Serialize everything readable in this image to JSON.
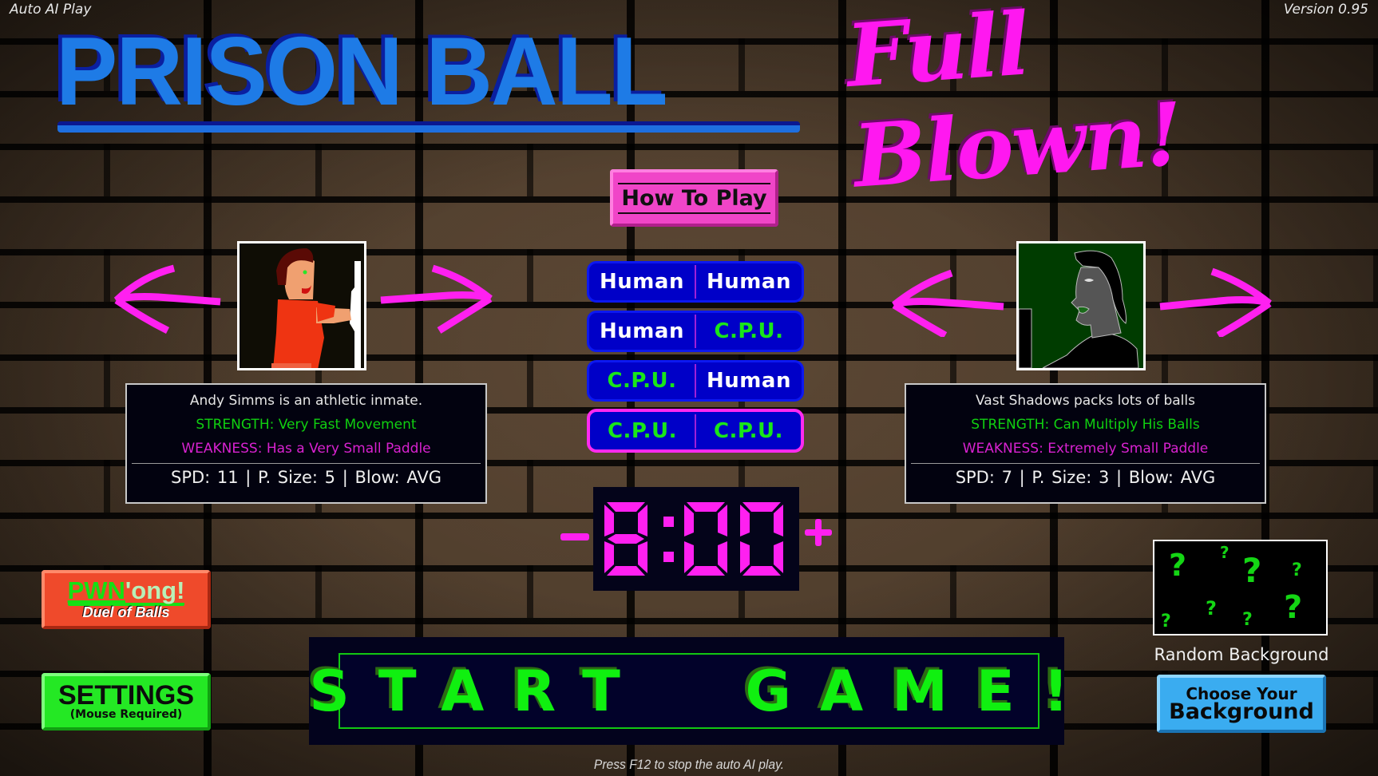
{
  "header": {
    "mode_label": "Auto AI Play",
    "version": "Version 0.95",
    "title_main": "PRISON BALL",
    "title_sub": "Full Blown!"
  },
  "how_to_play": {
    "label": "How To Play"
  },
  "colors": {
    "human": "#ffffff",
    "cpu": "#19e619",
    "accent_pink": "#ff20f0",
    "title_blue": "#1e7be6",
    "start_green": "#10f010"
  },
  "player_modes": [
    {
      "left": "Human",
      "right": "Human",
      "left_type": "human",
      "right_type": "human",
      "selected": false
    },
    {
      "left": "Human",
      "right": "C.P.U.",
      "left_type": "human",
      "right_type": "cpu",
      "selected": false
    },
    {
      "left": "C.P.U.",
      "right": "Human",
      "left_type": "cpu",
      "right_type": "human",
      "selected": false
    },
    {
      "left": "C.P.U.",
      "right": "C.P.U.",
      "left_type": "cpu",
      "right_type": "cpu",
      "selected": true
    }
  ],
  "players": {
    "left": {
      "name": "Andy Simms",
      "description": "Andy Simms is an athletic inmate.",
      "strength": "STRENGTH: Very Fast Movement",
      "weakness": "WEAKNESS: Has a Very Small Paddle",
      "stats": "SPD: 11  |  P. Size: 5  |  Blow: AVG"
    },
    "right": {
      "name": "Vast Shadows",
      "description": "Vast Shadows packs lots of balls",
      "strength": "STRENGTH: Can Multiply His Balls",
      "weakness": "WEAKNESS: Extremely Small Paddle",
      "stats": "SPD: 7  |  P. Size: 3  |  Blow: AVG"
    }
  },
  "timer": {
    "value": "8:00",
    "digits": [
      "8",
      ":",
      "0",
      "0"
    ],
    "minus_icon": "minus-icon",
    "plus_icon": "plus-icon"
  },
  "start": {
    "label": "START  GAME!"
  },
  "footer": {
    "hint": "Press F12 to stop the auto AI play."
  },
  "pwnong": {
    "title_part1": "PWN",
    "title_part2": "'ong!",
    "subtitle": "Duel of Balls"
  },
  "settings": {
    "label": "SETTINGS",
    "sublabel": "(Mouse Required)"
  },
  "background": {
    "preview_label": "Random Background",
    "preview_icon": "question-mark-icon",
    "choose_line1": "Choose Your",
    "choose_line2": "Background"
  }
}
